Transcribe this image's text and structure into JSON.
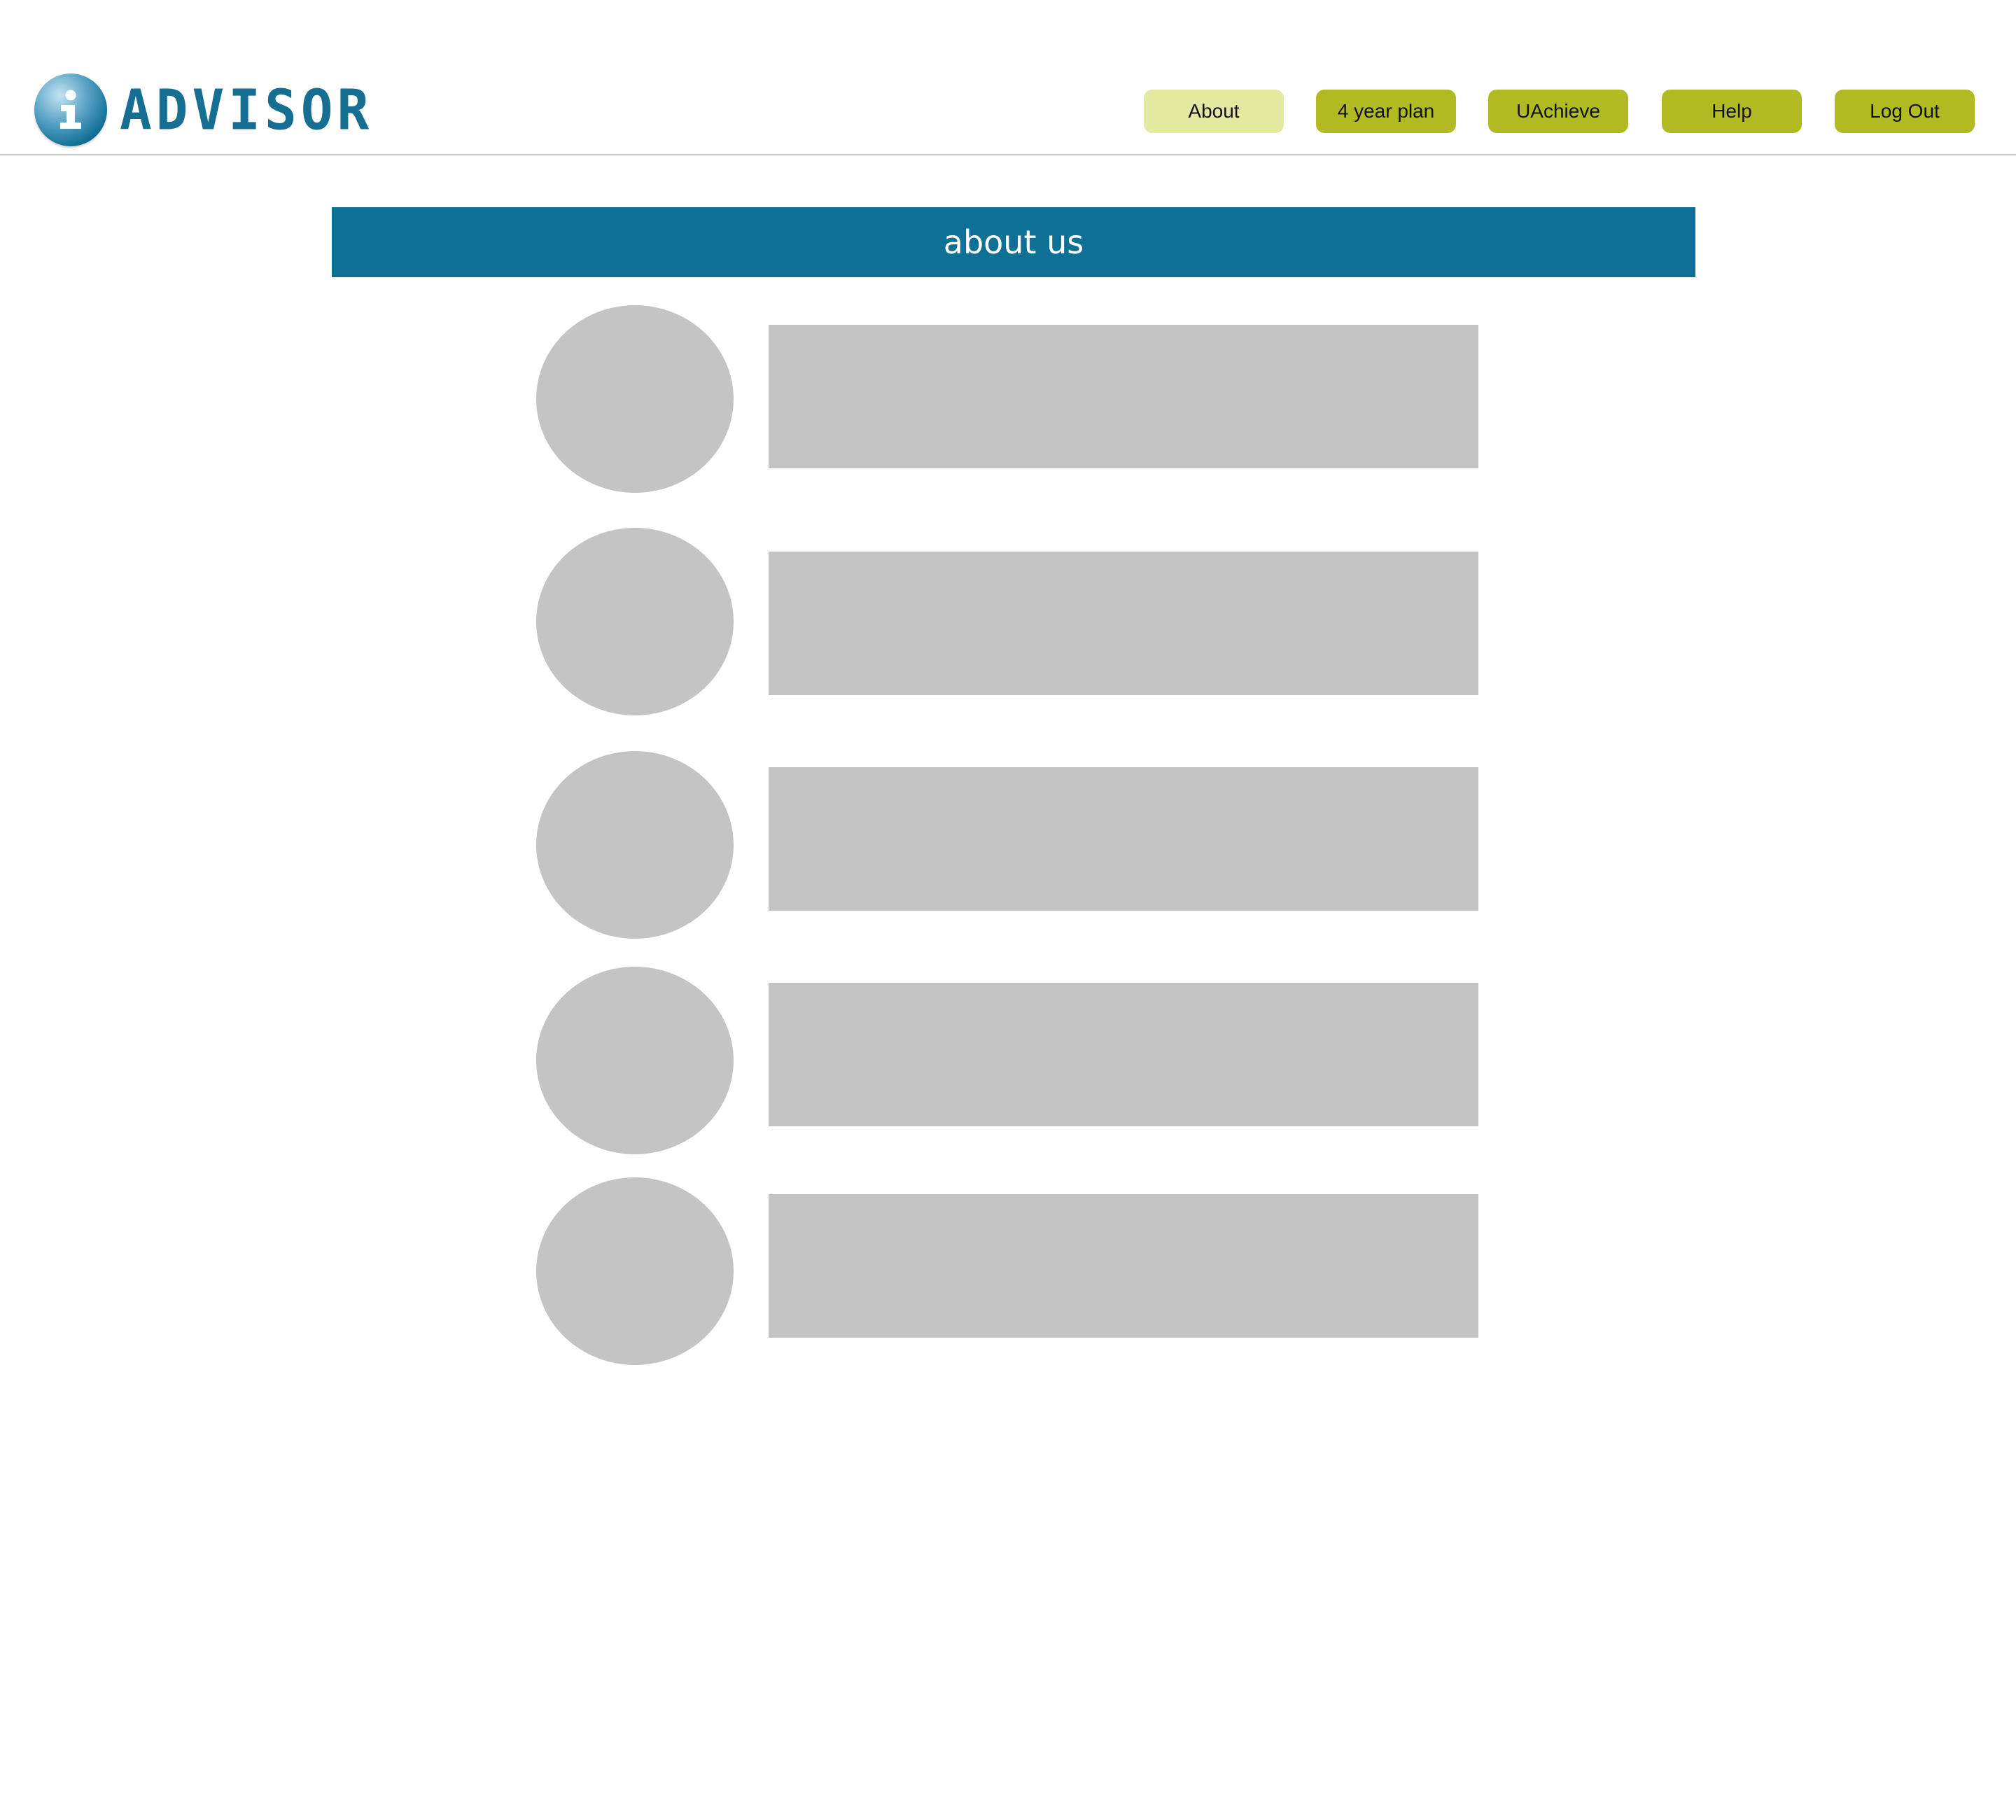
{
  "brand": {
    "logo_text": "ADVISOR",
    "logo_glyph": "i",
    "icon": "info-icon",
    "color": "#166e93"
  },
  "nav": {
    "items": [
      {
        "label": "About",
        "active": true
      },
      {
        "label": "4 year plan",
        "active": false
      },
      {
        "label": "UAchieve",
        "active": false
      },
      {
        "label": "Help",
        "active": false
      },
      {
        "label": "Log Out",
        "active": false
      }
    ],
    "active_color": "#e3e9a0",
    "color": "#b1ba22"
  },
  "page": {
    "title": "about us",
    "title_bar_color": "#0f7096"
  },
  "members": [
    {
      "avatar": "placeholder",
      "bio": ""
    },
    {
      "avatar": "placeholder",
      "bio": ""
    },
    {
      "avatar": "placeholder",
      "bio": ""
    },
    {
      "avatar": "placeholder",
      "bio": ""
    },
    {
      "avatar": "placeholder",
      "bio": ""
    }
  ],
  "placeholder_color": "#c4c4c4"
}
